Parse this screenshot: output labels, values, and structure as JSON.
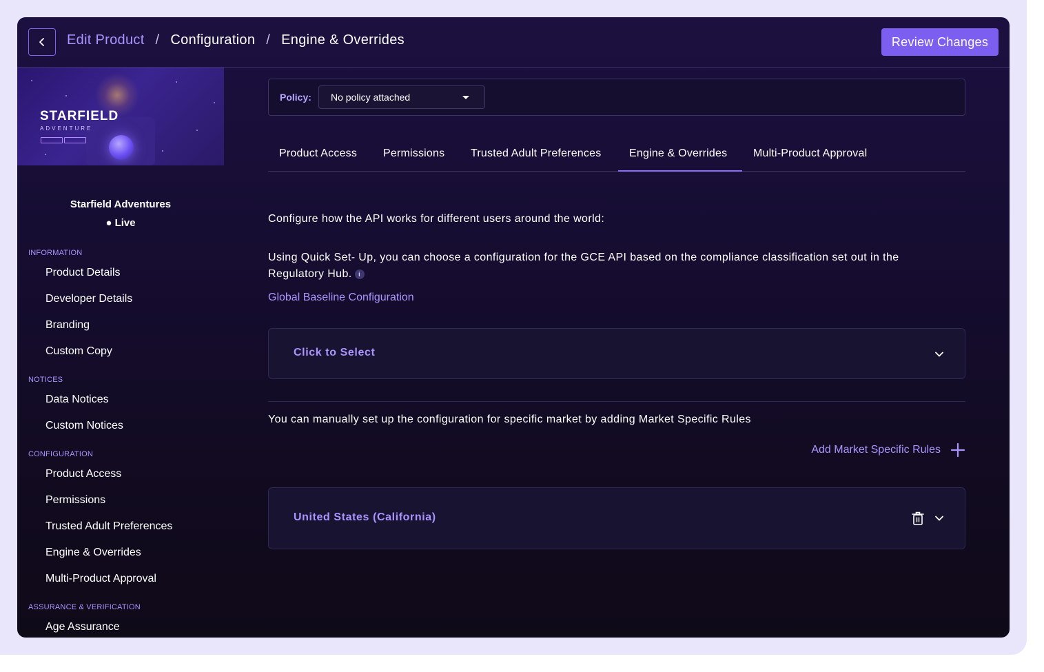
{
  "header": {
    "back_icon": "chevron-left-icon",
    "breadcrumb": [
      "Edit Product",
      "Configuration",
      "Engine & Overrides"
    ],
    "separator": "/",
    "review_label": "Review Changes"
  },
  "product": {
    "thumbnail_title": "STARFIELD",
    "thumbnail_subtitle": "ADVENTURE",
    "name": "Starfield Adventures",
    "status": "● Live"
  },
  "sidebar": {
    "sections": [
      {
        "title": "INFORMATION",
        "items": [
          "Product Details",
          "Developer Details",
          "Branding",
          "Custom Copy"
        ]
      },
      {
        "title": "NOTICES",
        "items": [
          "Data Notices",
          "Custom Notices"
        ]
      },
      {
        "title": "CONFIGURATION",
        "items": [
          "Product Access",
          "Permissions",
          "Trusted Adult Preferences",
          "Engine & Overrides",
          "Multi-Product Approval"
        ]
      },
      {
        "title": "ASSURANCE & VERIFICATION",
        "items": [
          "Age Assurance"
        ]
      }
    ]
  },
  "policy": {
    "label": "Policy:",
    "value": "No policy attached"
  },
  "tabs": [
    {
      "label": "Product Access",
      "active": false
    },
    {
      "label": "Permissions",
      "active": false
    },
    {
      "label": "Trusted Adult Preferences",
      "active": false
    },
    {
      "label": "Engine & Overrides",
      "active": true
    },
    {
      "label": "Multi-Product Approval",
      "active": false
    }
  ],
  "content": {
    "intro": "Configure how the API works for different users around the world:",
    "quick_setup_line1": "Using Quick Set- Up, you can choose a configuration for the GCE API based on the compliance classification set out in the",
    "quick_setup_line2": "Regulatory Hub.",
    "info_glyph": "i",
    "baseline_label": "Global Baseline Configuration",
    "baseline_select": "Click to Select",
    "manual_text": "You can manually set up the configuration for specific market by adding Market Specific Rules",
    "add_rules_label": "Add Market Specific Rules",
    "market_rule": "United States (California)"
  },
  "colors": {
    "accent": "#7c5ff0",
    "accent_text": "#a995ff",
    "frame": "#e9e6fb"
  }
}
